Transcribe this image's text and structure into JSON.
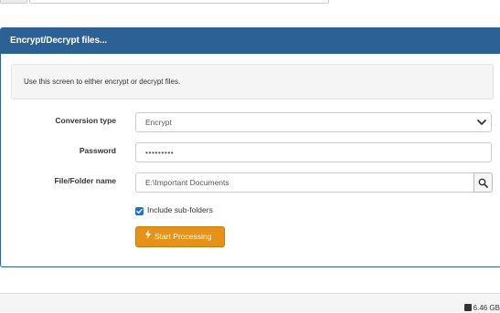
{
  "panel": {
    "title": "Encrypt/Decrypt files...",
    "intro": "Use this screen to either encrypt or decrypt files."
  },
  "form": {
    "conversion_type_label": "Conversion type",
    "conversion_type_value": "Encrypt",
    "password_label": "Password",
    "password_value": "•••••••••",
    "file_label": "File/Folder name",
    "file_value": "E:\\Important Documents",
    "include_subfolders_label": "Include sub-folders",
    "include_subfolders_checked": true,
    "start_label": "Start Processing"
  },
  "footer": {
    "disk_free": "6.46 GB"
  },
  "colors": {
    "header_bg": "#2c6195",
    "button_bg": "#e69118",
    "checkbox": "#1f6fd0"
  },
  "icons": {
    "select": "chevron-down-icon",
    "browse": "search-icon",
    "start": "bolt-icon",
    "disk": "disk-icon"
  }
}
